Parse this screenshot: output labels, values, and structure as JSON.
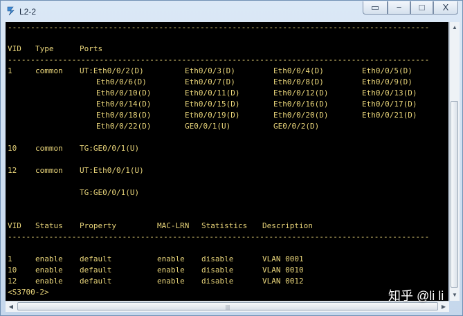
{
  "window": {
    "title": "L2-2",
    "buttons": {
      "extra": "▭",
      "minimize": "−",
      "maximize": "□",
      "close": "X"
    }
  },
  "terminal": {
    "separator": "--------------------------------------------------------------------------------------------",
    "header1": {
      "vid": "VID",
      "type": "Type",
      "ports": "Ports"
    },
    "vlan1_rows": [
      [
        "1",
        "common",
        "UT:Eth0/0/2(D)",
        "Eth0/0/3(D)",
        "Eth0/0/4(D)",
        "Eth0/0/5(D)"
      ],
      [
        "",
        "",
        "Eth0/0/6(D)",
        "Eth0/0/7(D)",
        "Eth0/0/8(D)",
        "Eth0/0/9(D)"
      ],
      [
        "",
        "",
        "Eth0/0/10(D)",
        "Eth0/0/11(D)",
        "Eth0/0/12(D)",
        "Eth0/0/13(D)"
      ],
      [
        "",
        "",
        "Eth0/0/14(D)",
        "Eth0/0/15(D)",
        "Eth0/0/16(D)",
        "Eth0/0/17(D)"
      ],
      [
        "",
        "",
        "Eth0/0/18(D)",
        "Eth0/0/19(D)",
        "Eth0/0/20(D)",
        "Eth0/0/21(D)"
      ],
      [
        "",
        "",
        "Eth0/0/22(D)",
        "GE0/0/1(U)",
        "GE0/0/2(D)",
        ""
      ]
    ],
    "vlan10": {
      "vid": "10",
      "type": "common",
      "ports": "TG:GE0/0/1(U)"
    },
    "vlan12": {
      "vid": "12",
      "type": "common",
      "ports": "UT:Eth0/0/1(U)",
      "ports2": "TG:GE0/0/1(U)"
    },
    "header2": {
      "vid": "VID",
      "status": "Status",
      "property": "Property",
      "mac_lrn": "MAC-LRN",
      "statistics": "Statistics",
      "description": "Description"
    },
    "status_rows": [
      {
        "vid": "1",
        "status": "enable",
        "property": "default",
        "mac_lrn": "enable",
        "statistics": "disable",
        "description": "VLAN 0001"
      },
      {
        "vid": "10",
        "status": "enable",
        "property": "default",
        "mac_lrn": "enable",
        "statistics": "disable",
        "description": "VLAN 0010"
      },
      {
        "vid": "12",
        "status": "enable",
        "property": "default",
        "mac_lrn": "enable",
        "statistics": "disable",
        "description": "VLAN 0012"
      }
    ],
    "prompt": "<S3700-2>"
  },
  "watermark": "知乎 @li li",
  "colors": {
    "terminal_bg": "#000000",
    "terminal_text": "#e9d57a",
    "chrome": "#cfe0f2"
  }
}
